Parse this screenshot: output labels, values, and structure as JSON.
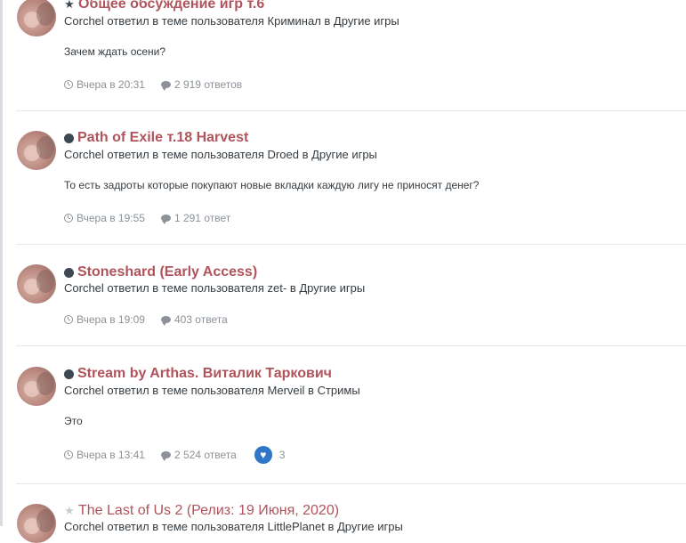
{
  "feed": {
    "items": [
      {
        "title": "Общее обсуждение игр т.6",
        "state_icon": "star-icon",
        "activity": "Corchel ответил в теме пользователя Криминал в Другие игры",
        "snippet": "Зачем ждать осени?",
        "time": "Вчера в 20:31",
        "replies": "2 919 ответов"
      },
      {
        "title": "Path of Exile т.18 Harvest",
        "state_icon": "unread-dot-icon",
        "activity": "Corchel ответил в теме пользователя Droed в Другие игры",
        "snippet": "То есть задроты которые покупают новые вкладки каждую лигу не приносят денег?",
        "time": "Вчера в 19:55",
        "replies": "1 291 ответ"
      },
      {
        "title": "Stoneshard (Early Access)",
        "state_icon": "unread-dot-icon",
        "activity": "Corchel ответил в теме пользователя zet- в Другие игры",
        "time": "Вчера в 19:09",
        "replies": "403 ответа"
      },
      {
        "title": "Stream by Arthas. Виталик Таркович",
        "state_icon": "unread-dot-icon",
        "activity": "Corchel ответил в теме пользователя Merveil в Стримы",
        "snippet": "Это",
        "time": "Вчера в 13:41",
        "replies": "2 524 ответа",
        "reactions": "3"
      },
      {
        "title": "The Last of Us 2 (Релиз: 19 Июня, 2020)",
        "state_icon": "star-outline-icon",
        "activity": "Corchel ответил в теме пользователя LittlePlanet в Другие игры"
      }
    ]
  },
  "colors": {
    "title": "#b0545c",
    "meta": "#8c9297",
    "reaction": "#2f77c6"
  }
}
